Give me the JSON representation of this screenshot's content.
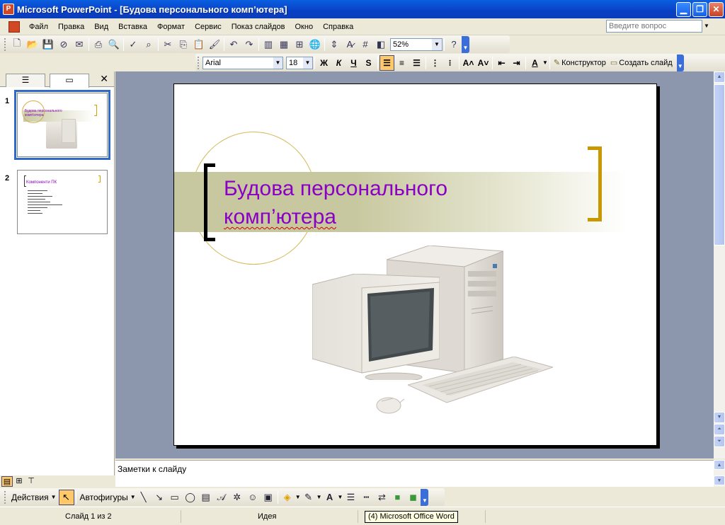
{
  "window": {
    "title": "Microsoft PowerPoint - [Будова персонального комп’ютера]",
    "controls": [
      "_",
      "❐",
      "✕"
    ]
  },
  "menu": {
    "items": [
      "Файл",
      "Правка",
      "Вид",
      "Вставка",
      "Формат",
      "Сервис",
      "Показ слайдов",
      "Окно",
      "Справка"
    ],
    "help_placeholder": "Введите вопрос"
  },
  "standard_toolbar": {
    "zoom": "52%"
  },
  "formatting_toolbar": {
    "font": "Arial",
    "size": "18",
    "bold": "Ж",
    "italic": "К",
    "underline": "Ч",
    "shadow": "S",
    "designer": "Конструктор",
    "new_slide": "Создать слайд"
  },
  "left_pane": {
    "slides": [
      {
        "number": "1",
        "title": "Будова персонального комп’ютера"
      },
      {
        "number": "2",
        "title": "Компоненти ПК"
      }
    ]
  },
  "slide": {
    "title_line1": "Будова персонального",
    "title_line2": "комп’ютера",
    "accent_color": "#8a00c4",
    "bracket_color": "#c89800"
  },
  "notes": {
    "placeholder": "Заметки к слайду"
  },
  "drawing_toolbar": {
    "actions": "Действия",
    "autoshapes": "Автофигуры"
  },
  "status": {
    "slide_counter": "Слайд 1 из 2",
    "design": "Идея",
    "tooltip": "(4) Microsoft Office Word"
  }
}
